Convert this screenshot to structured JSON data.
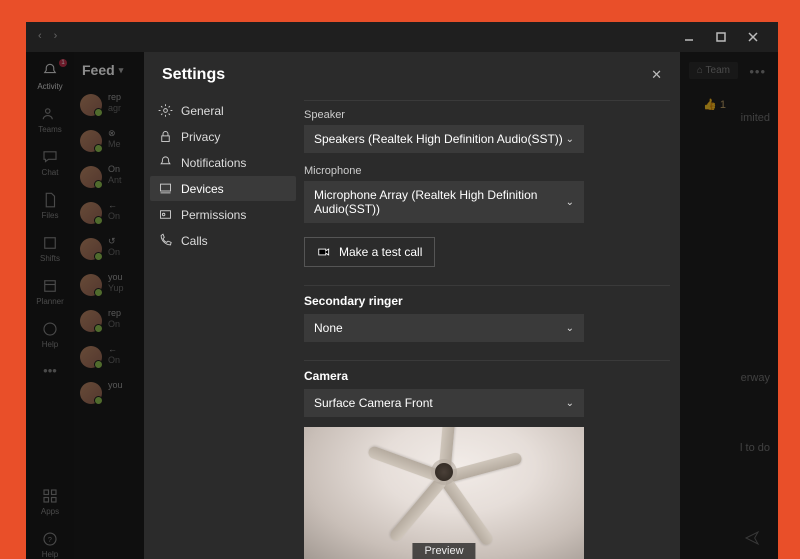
{
  "titlebar": {},
  "feed": {
    "header": "Feed"
  },
  "activity_badge": "1",
  "rail": {
    "items": [
      {
        "label": "Activity"
      },
      {
        "label": "Teams"
      },
      {
        "label": "Chat"
      },
      {
        "label": "Files"
      },
      {
        "label": "Shifts"
      },
      {
        "label": "Planner"
      },
      {
        "label": "Help"
      }
    ],
    "bottom": [
      {
        "label": "Apps"
      },
      {
        "label": "Help"
      }
    ]
  },
  "feed_items": [
    {
      "a": "rep",
      "b": "agr"
    },
    {
      "a": "⊗",
      "b": "Me"
    },
    {
      "a": "On",
      "b": "Ant"
    },
    {
      "a": "←",
      "b": "On"
    },
    {
      "a": "↺",
      "b": "On"
    },
    {
      "a": "you",
      "b": "Yup"
    },
    {
      "a": "rep",
      "b": "On"
    },
    {
      "a": "←",
      "b": "On"
    },
    {
      "a": "you",
      "b": ""
    }
  ],
  "main_bg": {
    "team_btn": "⌂ Team",
    "thumb": "👍 1",
    "snips": [
      "imited",
      "erway",
      "l to do"
    ]
  },
  "dialog": {
    "title": "Settings",
    "nav": [
      {
        "key": "general",
        "label": "General"
      },
      {
        "key": "privacy",
        "label": "Privacy"
      },
      {
        "key": "notifications",
        "label": "Notifications"
      },
      {
        "key": "devices",
        "label": "Devices"
      },
      {
        "key": "permissions",
        "label": "Permissions"
      },
      {
        "key": "calls",
        "label": "Calls"
      }
    ],
    "active_nav": "devices",
    "speaker": {
      "label": "Speaker",
      "value": "Speakers (Realtek High Definition Audio(SST))"
    },
    "microphone": {
      "label": "Microphone",
      "value": "Microphone Array (Realtek High Definition Audio(SST))"
    },
    "test_call_btn": "Make a test call",
    "secondary_ringer": {
      "heading": "Secondary ringer",
      "value": "None"
    },
    "camera": {
      "heading": "Camera",
      "value": "Surface Camera Front",
      "preview_label": "Preview"
    }
  }
}
